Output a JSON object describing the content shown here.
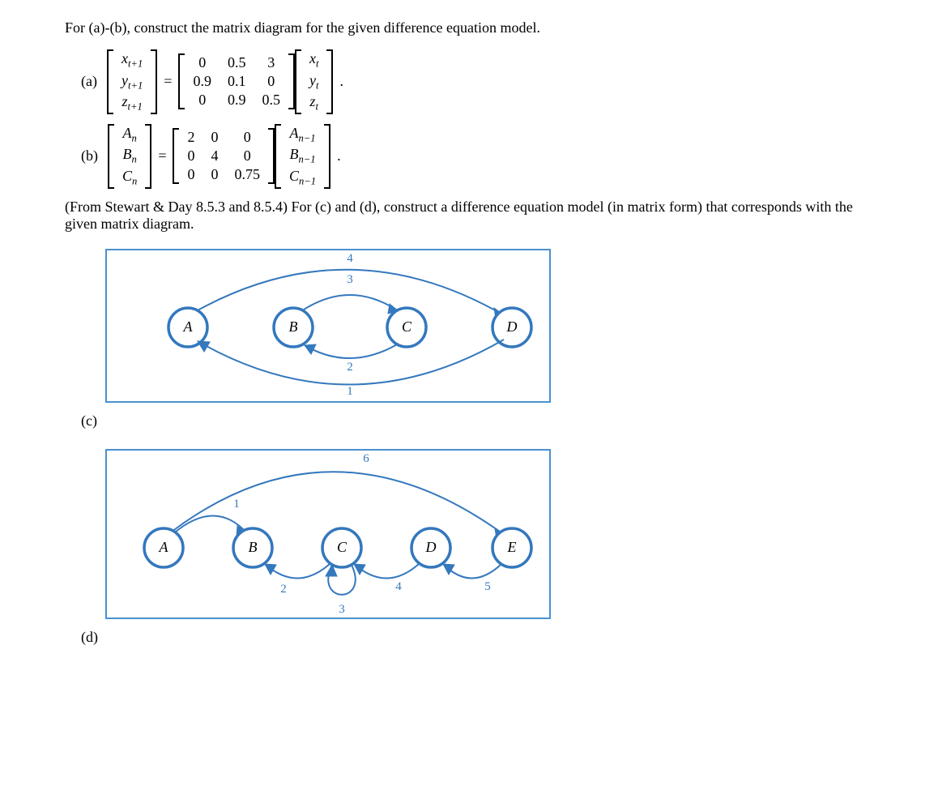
{
  "problem": {
    "opening": "For (a)-(b), construct the matrix diagram for the given difference equation model.",
    "part_a": {
      "label": "(a)",
      "lhs_vars": [
        "x",
        "y",
        "z"
      ],
      "lhs_sub": "t+1",
      "rhs_sub": "t",
      "matrix": [
        [
          "0",
          "0.5",
          "3"
        ],
        [
          "0.9",
          "0.1",
          "0"
        ],
        [
          "0",
          "0.9",
          "0.5"
        ]
      ]
    },
    "part_b": {
      "label": "(b)",
      "lhs_vars": [
        "A",
        "B",
        "C"
      ],
      "lhs_sub": "n",
      "rhs_sub": "n−1",
      "matrix": [
        [
          "2",
          "0",
          "0"
        ],
        [
          "0",
          "4",
          "0"
        ],
        [
          "0",
          "0",
          "0.75"
        ]
      ]
    },
    "second": "(From Stewart & Day 8.5.3 and 8.5.4) For (c) and (d), construct a difference equation model (in matrix form) that corresponds with the given matrix diagram.",
    "part_c": {
      "label": "(c)",
      "nodes": [
        "A",
        "B",
        "C",
        "D"
      ],
      "edge_labels": {
        "D_to_A": "1",
        "C_to_B": "2",
        "B_to_C_top": "3",
        "A_to_D": "4"
      }
    },
    "part_d": {
      "label": "(d)",
      "nodes": [
        "A",
        "B",
        "C",
        "D",
        "E"
      ],
      "edge_labels": {
        "A_to_B": "1",
        "C_to_B": "2",
        "C_to_C": "3",
        "D_to_C": "4",
        "E_to_D": "5",
        "A_to_E": "6"
      }
    }
  }
}
